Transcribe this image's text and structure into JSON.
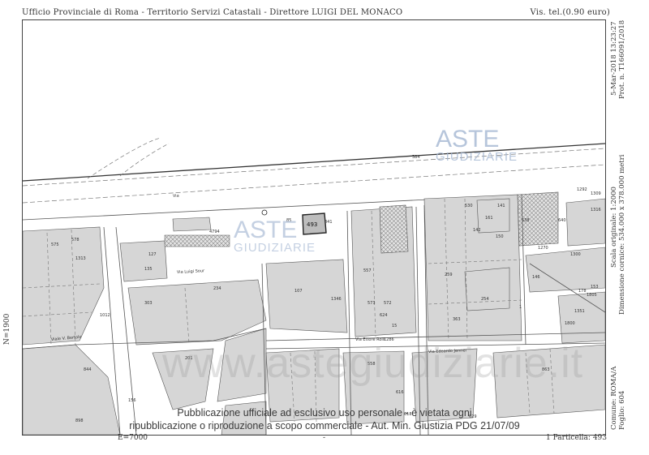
{
  "header": {
    "left": "Ufficio Provinciale di Roma - Territorio Servizi Catastali - Direttore LUIGI DEL MONACO",
    "right": "Vis. tel.(0.90 euro)"
  },
  "side_right": {
    "datetime": "5-Mar-2018 13:23:27",
    "protocol": "Prot. n. T166091/2018",
    "scale": "Scala originale: 1:2000",
    "frame": "Dimensione cornice: 534.000 x 378.000 metri",
    "comune": "Comune: ROMA/A",
    "foglio": "Foglio: 604"
  },
  "coords": {
    "north": "N=1900",
    "east": "E=7000",
    "mid_tick": "-"
  },
  "footer": {
    "particella": "1 Particella: 493"
  },
  "watermark": {
    "aste_line1": "ASTE",
    "aste_line2": "GIUDIZIARIE",
    "site": "www.astegiudiziarie.it",
    "notice_line1": "Pubblicazione ufficiale ad esclusivo uso personale - è vietata ogni",
    "notice_line2": "ripubblicazione o riproduzione a scopo commerciale - Aut. Min. Giustizia PDG 21/07/09",
    "color": "#8fa6c8"
  },
  "map": {
    "streets": [
      "Via Luigi Sour",
      "Via Edoardo Jenner",
      "Via Ettore Rolli",
      "Viale V. Bertolo",
      "Via"
    ],
    "parcels": [
      "493",
      "841",
      "575",
      "578",
      "1346",
      "640",
      "638",
      "1300",
      "530",
      "1270",
      "584",
      "572",
      "557",
      "573",
      "1012",
      "624",
      "15",
      "1",
      "156",
      "1286",
      "4794",
      "85",
      "127",
      "135",
      "1313",
      "234",
      "107",
      "201",
      "303",
      "844",
      "863",
      "616",
      "618",
      "898",
      "629",
      "558",
      "161",
      "259",
      "254",
      "363",
      "146",
      "1800",
      "1805",
      "153",
      "178",
      "141",
      "150",
      "142",
      "1292",
      "1309",
      "1316",
      "1351"
    ]
  }
}
